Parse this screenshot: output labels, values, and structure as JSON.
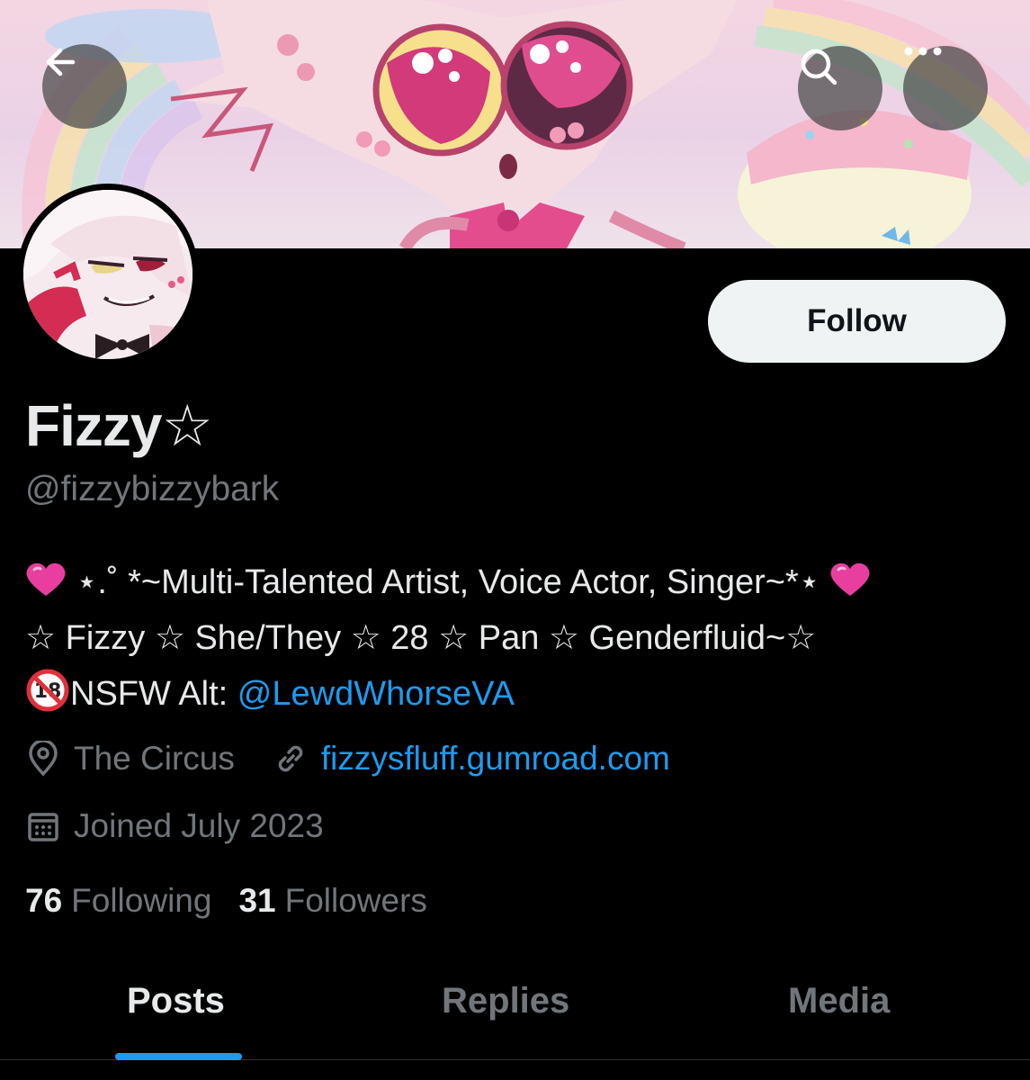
{
  "header": {
    "back_icon": "arrow-left-icon",
    "search_icon": "search-icon",
    "more_icon": "more-horizontal-icon"
  },
  "profile": {
    "display_name": "Fizzy☆",
    "handle": "@fizzybizzybark",
    "follow_label": "Follow",
    "bio": {
      "line1": "⋆.˚ *~Multi-Talented Artist, Voice Actor, Singer~*⋆",
      "line2": "☆ Fizzy ☆ She/They ☆ 28 ☆ Pan ☆ Genderfluid~☆",
      "line3_prefix": "NSFW Alt: ",
      "line3_link": "@LewdWhorseVA"
    },
    "location": "The Circus",
    "website": "fizzysfluff.gumroad.com",
    "joined": "Joined July 2023"
  },
  "stats": {
    "following_count": "76",
    "following_label": "Following",
    "followers_count": "31",
    "followers_label": "Followers"
  },
  "tabs": [
    {
      "label": "Posts",
      "active": true
    },
    {
      "label": "Replies",
      "active": false
    },
    {
      "label": "Media",
      "active": false
    }
  ],
  "colors": {
    "background": "#000000",
    "accent": "#1d9bf0",
    "muted": "#71767b",
    "text": "#e7e9ea"
  }
}
